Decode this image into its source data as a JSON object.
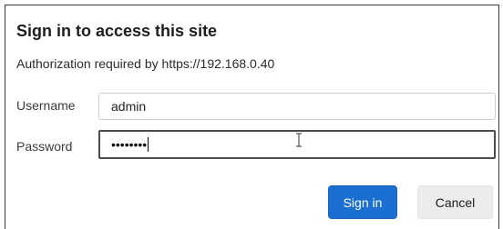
{
  "dialog": {
    "title": "Sign in to access this site",
    "subtitle": "Authorization required by https://192.168.0.40"
  },
  "form": {
    "username_label": "Username",
    "username_value": "admin",
    "password_label": "Password",
    "password_masked": "••••••••"
  },
  "buttons": {
    "signin_label": "Sign in",
    "cancel_label": "Cancel"
  },
  "colors": {
    "primary": "#1a6fd0",
    "secondary": "#ececec"
  },
  "icons": {
    "text_cursor": "i-beam-cursor-icon"
  }
}
